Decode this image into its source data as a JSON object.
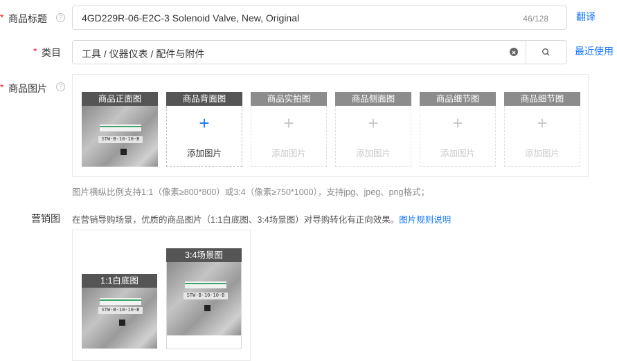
{
  "title_row": {
    "required_mark": "*",
    "label": "商品标题",
    "help_icon": "question-circle-icon",
    "value": "4GD229R-06-E2C-3 Solenoid Valve, New, Original",
    "counter": "46/128",
    "translate_link": "翻译"
  },
  "category_row": {
    "required_mark": "*",
    "label": "类目",
    "value": "工具 / 仪器仪表 / 配件与附件",
    "clear_icon": "close-circle-icon",
    "search_icon": "search-icon",
    "recent_link": "最近使用"
  },
  "images_row": {
    "required_mark": "*",
    "label": "商品图片",
    "help_icon": "question-circle-icon",
    "slots": [
      {
        "title": "商品正面图"
      },
      {
        "title": "商品背面图",
        "add_label": "添加图片"
      },
      {
        "title": "商品实拍图",
        "add_label": "添加图片"
      },
      {
        "title": "商品侧面图",
        "add_label": "添加图片"
      },
      {
        "title": "商品细节图",
        "add_label": "添加图片"
      },
      {
        "title": "商品细节图",
        "add_label": "添加图片"
      }
    ],
    "hint": "图片横纵比例支持1:1（像素≥800*800）或3:4（像素≥750*1000），支持jpg、jpeg、png格式；"
  },
  "marketing_row": {
    "label": "营销图",
    "description": "在营销导购场景，优质的商品图片（1:1白底图、3:4场景图）对导购转化有正向效果。",
    "rules_link": "图片规则说明",
    "images": [
      {
        "title": "1:1白底图"
      },
      {
        "title": "3:4场景图"
      }
    ]
  }
}
